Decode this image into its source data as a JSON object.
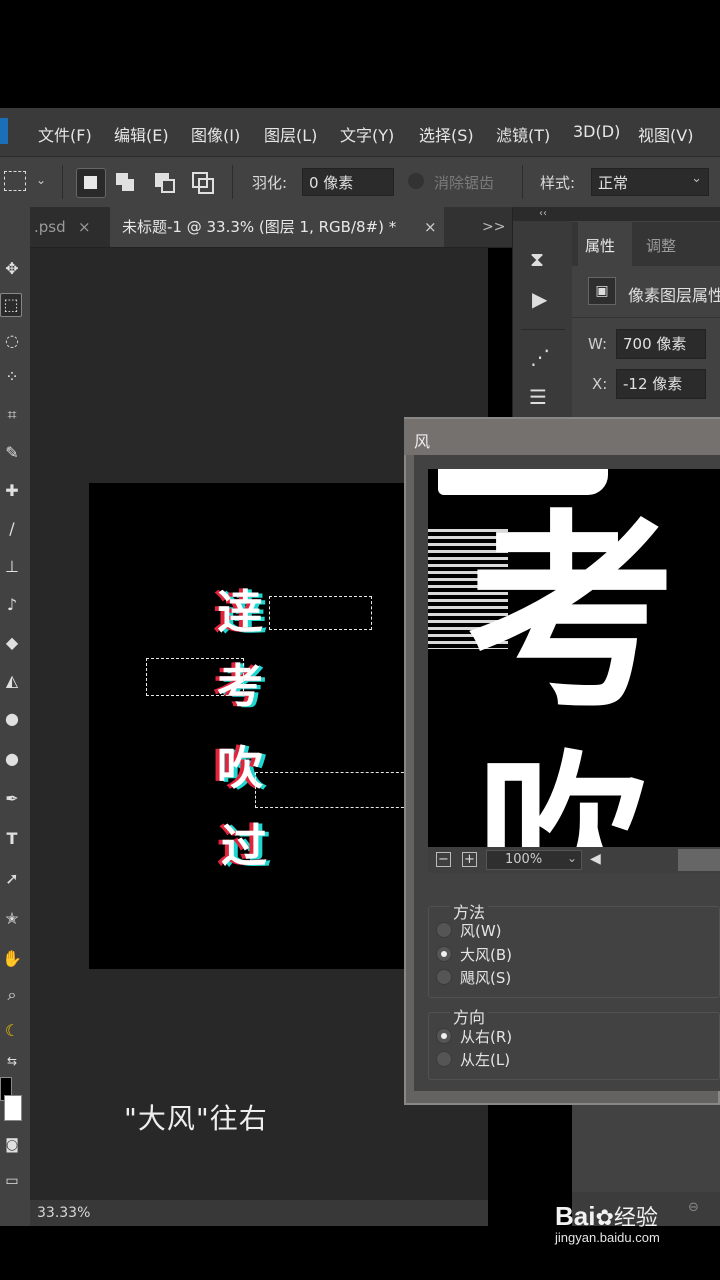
{
  "menu": [
    "文件(F)",
    "编辑(E)",
    "图像(I)",
    "图层(L)",
    "文字(Y)",
    "选择(S)",
    "滤镜(T)",
    "3D(D)",
    "视图(V)"
  ],
  "options": {
    "feather_label": "羽化:",
    "feather_value": "0 像素",
    "antialias_label": "消除锯齿",
    "style_label": "样式:",
    "style_value": "正常"
  },
  "tabs": {
    "prev_tab": ".psd",
    "active_tab": "未标题-1 @ 33.3% (图层 1, RGB/8#) *",
    "close_icon": "×",
    "overflow": ">>"
  },
  "canvas": {
    "glyphs": [
      "逹",
      "考",
      "吹",
      "过"
    ],
    "caption": "\"大风\"往右"
  },
  "status": {
    "zoom": "33.33%"
  },
  "properties_panel": {
    "tab_properties": "属性",
    "tab_adjust": "调整",
    "layer_type": "像素图层属性",
    "w_label": "W:",
    "w_value": "700 像素",
    "x_label": "X:",
    "x_value": "-12 像素"
  },
  "wind_dialog": {
    "title": "风",
    "zoom_value": "100%",
    "method_legend": "方法",
    "methods": [
      {
        "label": "风(W)",
        "selected": false
      },
      {
        "label": "大风(B)",
        "selected": true
      },
      {
        "label": "飓风(S)",
        "selected": false
      }
    ],
    "direction_legend": "方向",
    "directions": [
      {
        "label": "从右(R)",
        "selected": true
      },
      {
        "label": "从左(L)",
        "selected": false
      }
    ],
    "preview_glyphs": [
      "考",
      "吹"
    ]
  },
  "watermark": {
    "brand": "Bai",
    "brand2": "经验",
    "url": "jingyan.baidu.com"
  },
  "colors": {
    "accent_red": "#e0243c",
    "accent_cyan": "#1fd6d0",
    "ps_blue": "#1b6fb8"
  }
}
